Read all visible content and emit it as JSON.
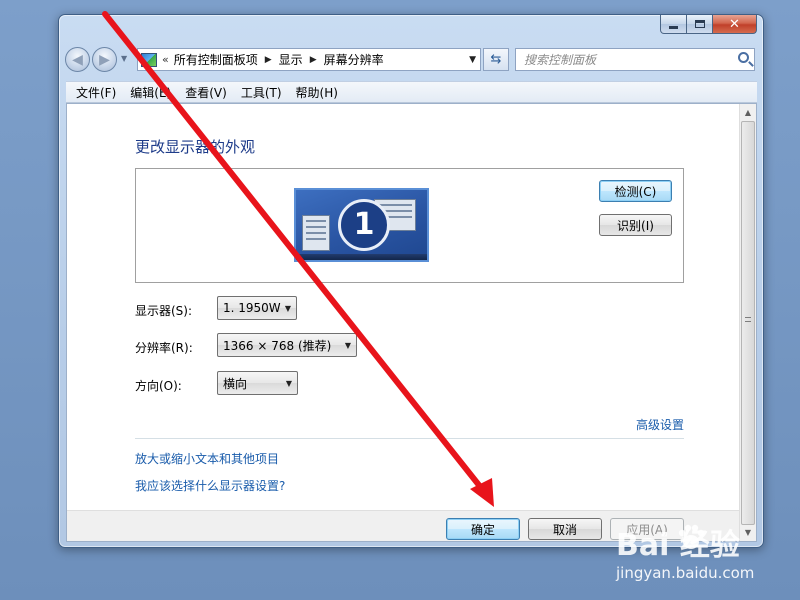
{
  "window": {
    "caption": {
      "minimize_icon": "minimize-icon",
      "maximize_icon": "maximize-icon",
      "close_icon": "close-icon",
      "close_glyph": "✕"
    }
  },
  "navigation": {
    "back_glyph": "◀",
    "forward_glyph": "▶",
    "breadcrumb_prefix": "«",
    "breadcrumbs": [
      "所有控制面板项",
      "显示",
      "屏幕分辨率"
    ],
    "search_placeholder": "搜索控制面板"
  },
  "menu": {
    "items": [
      "文件(F)",
      "编辑(E)",
      "查看(V)",
      "工具(T)",
      "帮助(H)"
    ]
  },
  "main": {
    "title": "更改显示器的外观",
    "monitor_number": "1",
    "detect_label": "检测(C)",
    "identify_label": "识别(I)",
    "display_label": "显示器(S):",
    "display_value": "1. 1950W",
    "resolution_label": "分辨率(R):",
    "resolution_value": "1366 × 768 (推荐)",
    "orientation_label": "方向(O):",
    "orientation_value": "横向",
    "advanced_link": "高级设置",
    "text_size_link": "放大或缩小文本和其他项目",
    "help_link": "我应该选择什么显示器设置?"
  },
  "buttons": {
    "ok": "确定",
    "cancel": "取消",
    "apply": "应用(A)"
  },
  "watermark": {
    "logo": "Bai  经验",
    "url": "jingyan.baidu.com"
  },
  "colors": {
    "link": "#1a5cab",
    "title": "#1e3c8a",
    "annotation_arrow": "#e8141b"
  }
}
